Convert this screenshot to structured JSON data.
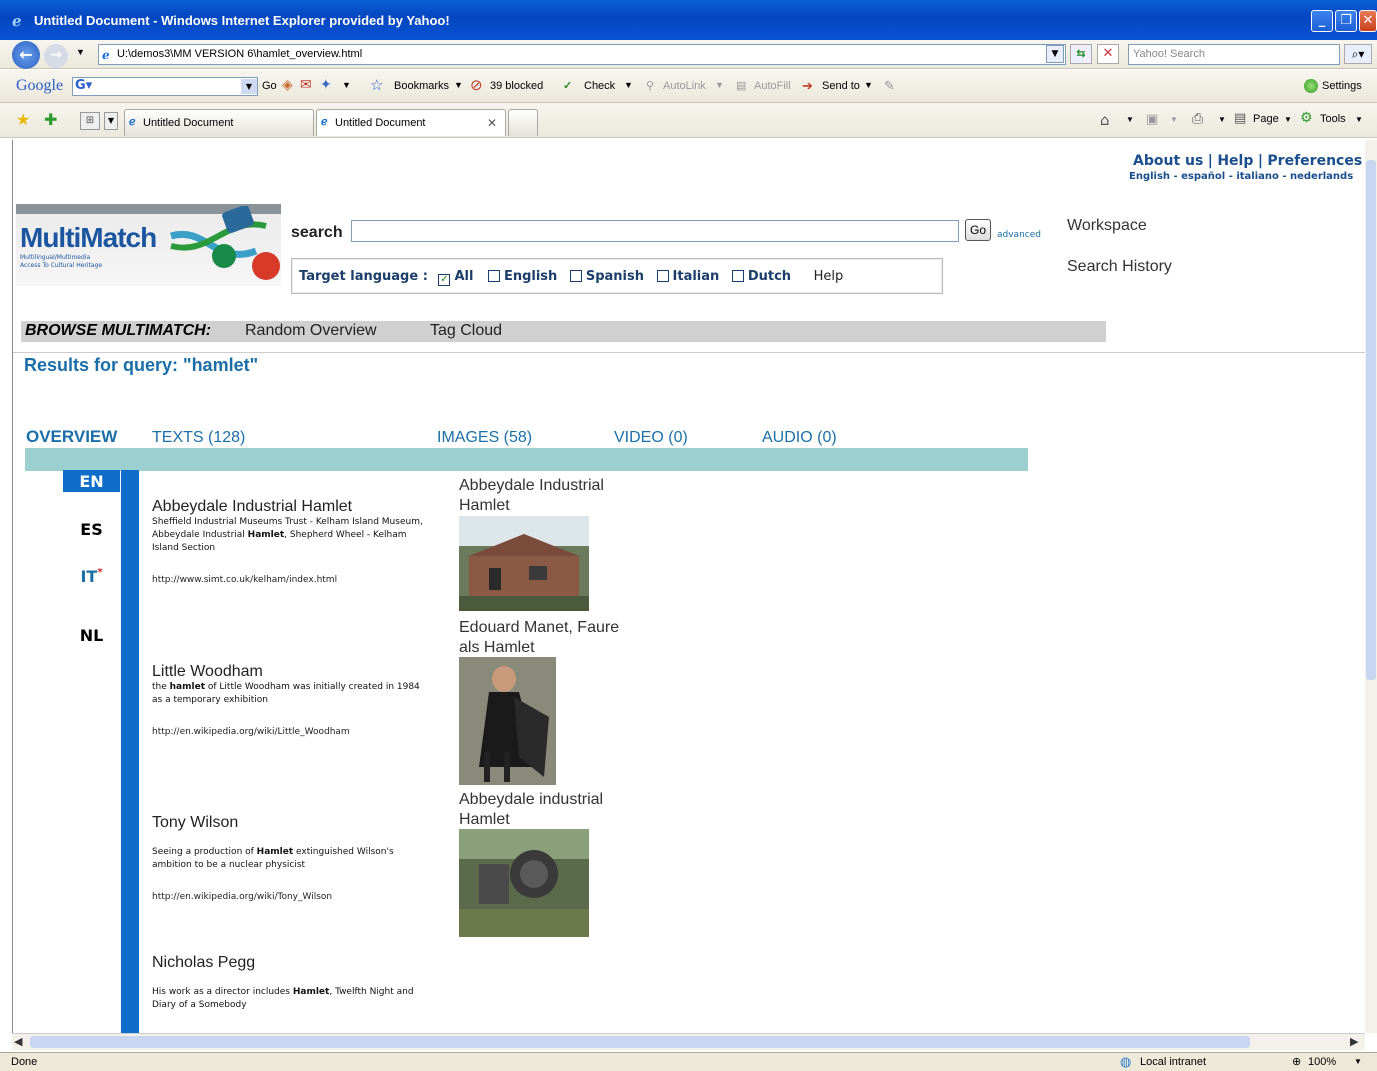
{
  "window": {
    "title": "Untitled Document - Windows Internet Explorer provided by Yahoo!"
  },
  "addressbar": {
    "url": "U:\\demos3\\MM VERSION 6\\hamlet_overview.html",
    "search_placeholder": "Yahoo! Search"
  },
  "google_bar": {
    "logo": "Google",
    "go": "Go",
    "bookmarks": "Bookmarks",
    "blocked": "39 blocked",
    "check": "Check",
    "autolink": "AutoLink",
    "autofill": "AutoFill",
    "send_to": "Send to",
    "settings": "Settings"
  },
  "tabs": [
    {
      "label": "Untitled Document"
    },
    {
      "label": "Untitled Document"
    }
  ],
  "command_bar": {
    "page": "Page",
    "tools": "Tools"
  },
  "page": {
    "top_links": {
      "about": "About us",
      "help": "Help",
      "preferences": "Preferences",
      "sep": "|"
    },
    "languages_line": "English - español - italiano - nederlands",
    "logo": {
      "name": "MultiMatch",
      "tagline1": "Multilingual/Multimedia",
      "tagline2": "Access To Cultural Heritage"
    },
    "search": {
      "label": "search",
      "go": "Go",
      "advanced": "advanced",
      "value": ""
    },
    "target_language": {
      "label": "Target language :",
      "options": [
        {
          "label": "All",
          "checked": true
        },
        {
          "label": "English",
          "checked": false
        },
        {
          "label": "Spanish",
          "checked": false
        },
        {
          "label": "Italian",
          "checked": false
        },
        {
          "label": "Dutch",
          "checked": false
        }
      ],
      "help": "Help"
    },
    "side_links": {
      "workspace": "Workspace",
      "history": "Search History"
    },
    "browse": {
      "label": "BROWSE MULTIMATCH:",
      "random": "Random Overview",
      "tagcloud": "Tag Cloud"
    },
    "results_heading": "Results for query: \"hamlet\"",
    "result_tabs": {
      "overview": "OVERVIEW",
      "texts": "TEXTS (128)",
      "images": "IMAGES (58)",
      "video": "VIDEO (0)",
      "audio": "AUDIO (0)"
    },
    "lang_tabs": {
      "en": "EN",
      "es": "ES",
      "it": "IT",
      "it_mark": "*",
      "nl": "NL"
    },
    "texts": [
      {
        "title": "Abbeydale Industrial Hamlet",
        "snippet_a": "Sheffield Industrial Museums Trust - Kelham Island Museum, Abbeydale Industrial ",
        "snippet_b": "Hamlet",
        "snippet_c": ", Shepherd Wheel - Kelham Island Section",
        "url": "http://www.simt.co.uk/kelham/index.html"
      },
      {
        "title": "Little Woodham",
        "snippet_a": "the ",
        "snippet_b": "hamlet",
        "snippet_c": " of Little Woodham was initially created in 1984 as a temporary exhibition",
        "url": "http://en.wikipedia.org/wiki/Little_Woodham"
      },
      {
        "title": "Tony Wilson",
        "snippet_a": "Seeing a production of ",
        "snippet_b": "Hamlet",
        "snippet_c": " extinguished Wilson's ambition to be a nuclear physicist",
        "url": "http://en.wikipedia.org/wiki/Tony_Wilson"
      },
      {
        "title": "Nicholas Pegg",
        "snippet_a": "His work as a director includes ",
        "snippet_b": "Hamlet",
        "snippet_c": ", Twelfth Night and Diary of a Somebody",
        "url": ""
      }
    ],
    "images": [
      {
        "caption": "Abbeydale Industrial Hamlet"
      },
      {
        "caption": "Edouard Manet, Faure als Hamlet"
      },
      {
        "caption": "Abbeydale industrial Hamlet"
      }
    ]
  },
  "statusbar": {
    "status": "Done",
    "zone": "Local intranet",
    "zoom": "100%"
  }
}
